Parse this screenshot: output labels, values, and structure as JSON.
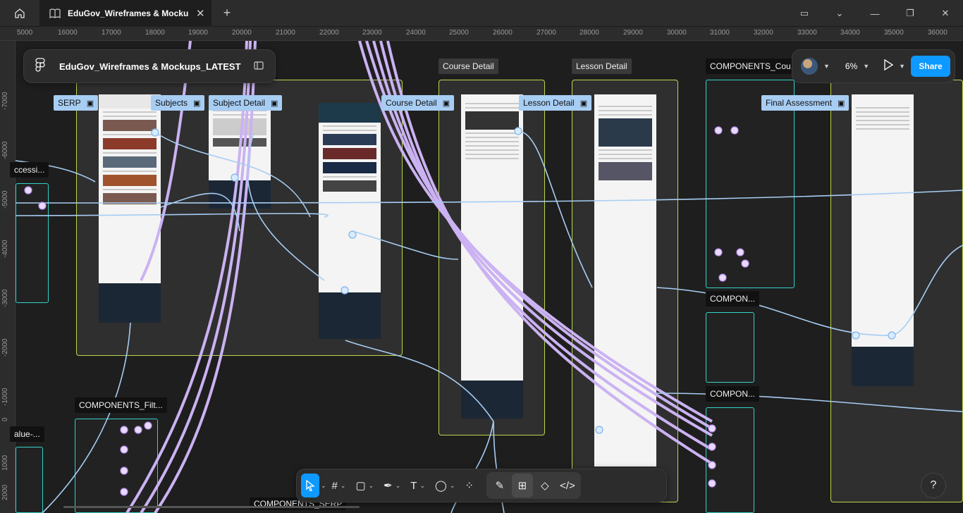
{
  "tabbar": {
    "home_icon": "home-icon",
    "tab_icon": "book-icon",
    "tab_title": "EduGov_Wireframes & Mockups_L",
    "close_label": "✕",
    "new_tab_label": "+",
    "window_icons": [
      "page-icon",
      "chevron-down-icon",
      "minimize-icon",
      "restore-icon",
      "close-icon"
    ]
  },
  "filebar": {
    "name": "EduGov_Wireframes & Mockups_LATEST"
  },
  "rightbar": {
    "zoom": "6%",
    "share_label": "Share"
  },
  "rulers": {
    "top": [
      "5000",
      "16000",
      "17000",
      "18000",
      "19000",
      "20000",
      "21000",
      "22000",
      "23000",
      "24000",
      "25000",
      "26000",
      "27000",
      "28000",
      "29000",
      "30000",
      "31000",
      "32000",
      "33000",
      "34000",
      "35000",
      "36000"
    ],
    "left": [
      "-7000",
      "-6000",
      "-5000",
      "-4000",
      "-3000",
      "-2000",
      "-1000",
      "0",
      "1000",
      "2000"
    ]
  },
  "labels": {
    "serp": "SERP",
    "subjects": "Subjects",
    "subject_detail": "Subject Detail",
    "course_detail_pill": "Course Detail",
    "lesson_detail_pill": "Lesson Detail",
    "final_assessment": "Final Assessment",
    "course_detail_section": "Course Detail",
    "lesson_detail_section": "Lesson Detail",
    "components_cou": "COMPONENTS_Cou...",
    "components_a": "COMPON...",
    "components_b": "COMPON...",
    "components_filt": "COMPONENTS_Filt...",
    "components_serp": "COMPONENTS_SERP",
    "accessi": "ccessi...",
    "value": "alue-..."
  },
  "toolbar": {
    "tools": [
      "move-icon",
      "frame-icon",
      "rectangle-icon",
      "pen-icon",
      "text-icon",
      "comment-icon",
      "actions-icon"
    ],
    "modes": [
      "draw-icon",
      "design-icon",
      "prototype-icon",
      "dev-mode-icon"
    ]
  },
  "help_label": "?"
}
